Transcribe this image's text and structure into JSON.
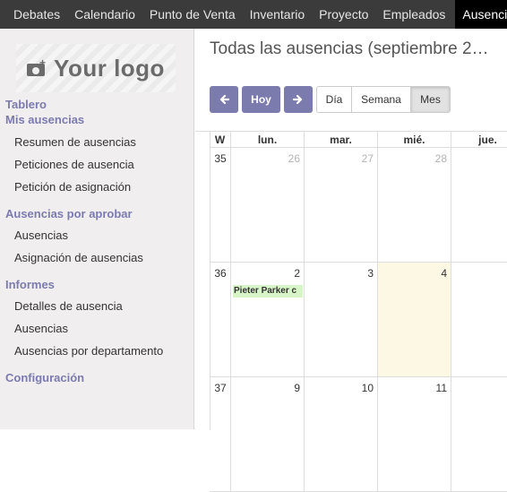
{
  "topbar": {
    "items": [
      "Debates",
      "Calendario",
      "Punto de Venta",
      "Inventario",
      "Proyecto",
      "Empleados",
      "Ausencias"
    ],
    "active": "Ausencias"
  },
  "sidebar": {
    "logo_text": "Your logo",
    "sections": [
      {
        "title": "Tablero",
        "items": []
      },
      {
        "title": "Mis ausencias",
        "items": [
          "Resumen de ausencias",
          "Peticiones de ausencia",
          "Petición de asignación"
        ]
      },
      {
        "title": "Ausencias por aprobar",
        "items": [
          "Ausencias",
          "Asignación de ausencias"
        ]
      },
      {
        "title": "Informes",
        "items": [
          "Detalles de ausencia",
          "Ausencias",
          "Ausencias por departamento"
        ]
      },
      {
        "title": "Configuración",
        "items": []
      }
    ]
  },
  "main": {
    "title": "Todas las ausencias (septiembre 2…",
    "controls": {
      "prev_icon": "arrow-left-icon",
      "today_label": "Hoy",
      "next_icon": "arrow-right-icon",
      "views": [
        "Día",
        "Semana",
        "Mes"
      ],
      "active_view": "Mes"
    },
    "calendar": {
      "week_header": "W",
      "day_headers": [
        "lun.",
        "mar.",
        "mié.",
        "jue."
      ],
      "weeks": [
        {
          "week": "35",
          "days": [
            {
              "num": "26",
              "other": true
            },
            {
              "num": "27",
              "other": true
            },
            {
              "num": "28",
              "other": true
            },
            {
              "num": "",
              "other": false
            }
          ]
        },
        {
          "week": "36",
          "days": [
            {
              "num": "2",
              "other": false,
              "event": "Pieter Parker c"
            },
            {
              "num": "3",
              "other": false
            },
            {
              "num": "4",
              "other": false,
              "today": true
            },
            {
              "num": "",
              "other": false
            }
          ]
        },
        {
          "week": "37",
          "days": [
            {
              "num": "9",
              "other": false
            },
            {
              "num": "10",
              "other": false
            },
            {
              "num": "11",
              "other": false
            },
            {
              "num": "",
              "other": false
            }
          ]
        }
      ]
    }
  },
  "colors": {
    "accent": "#7c7bad",
    "topbar": "#3b3b3b",
    "today": "#fcf8e3",
    "event": "#d8f5c8"
  }
}
